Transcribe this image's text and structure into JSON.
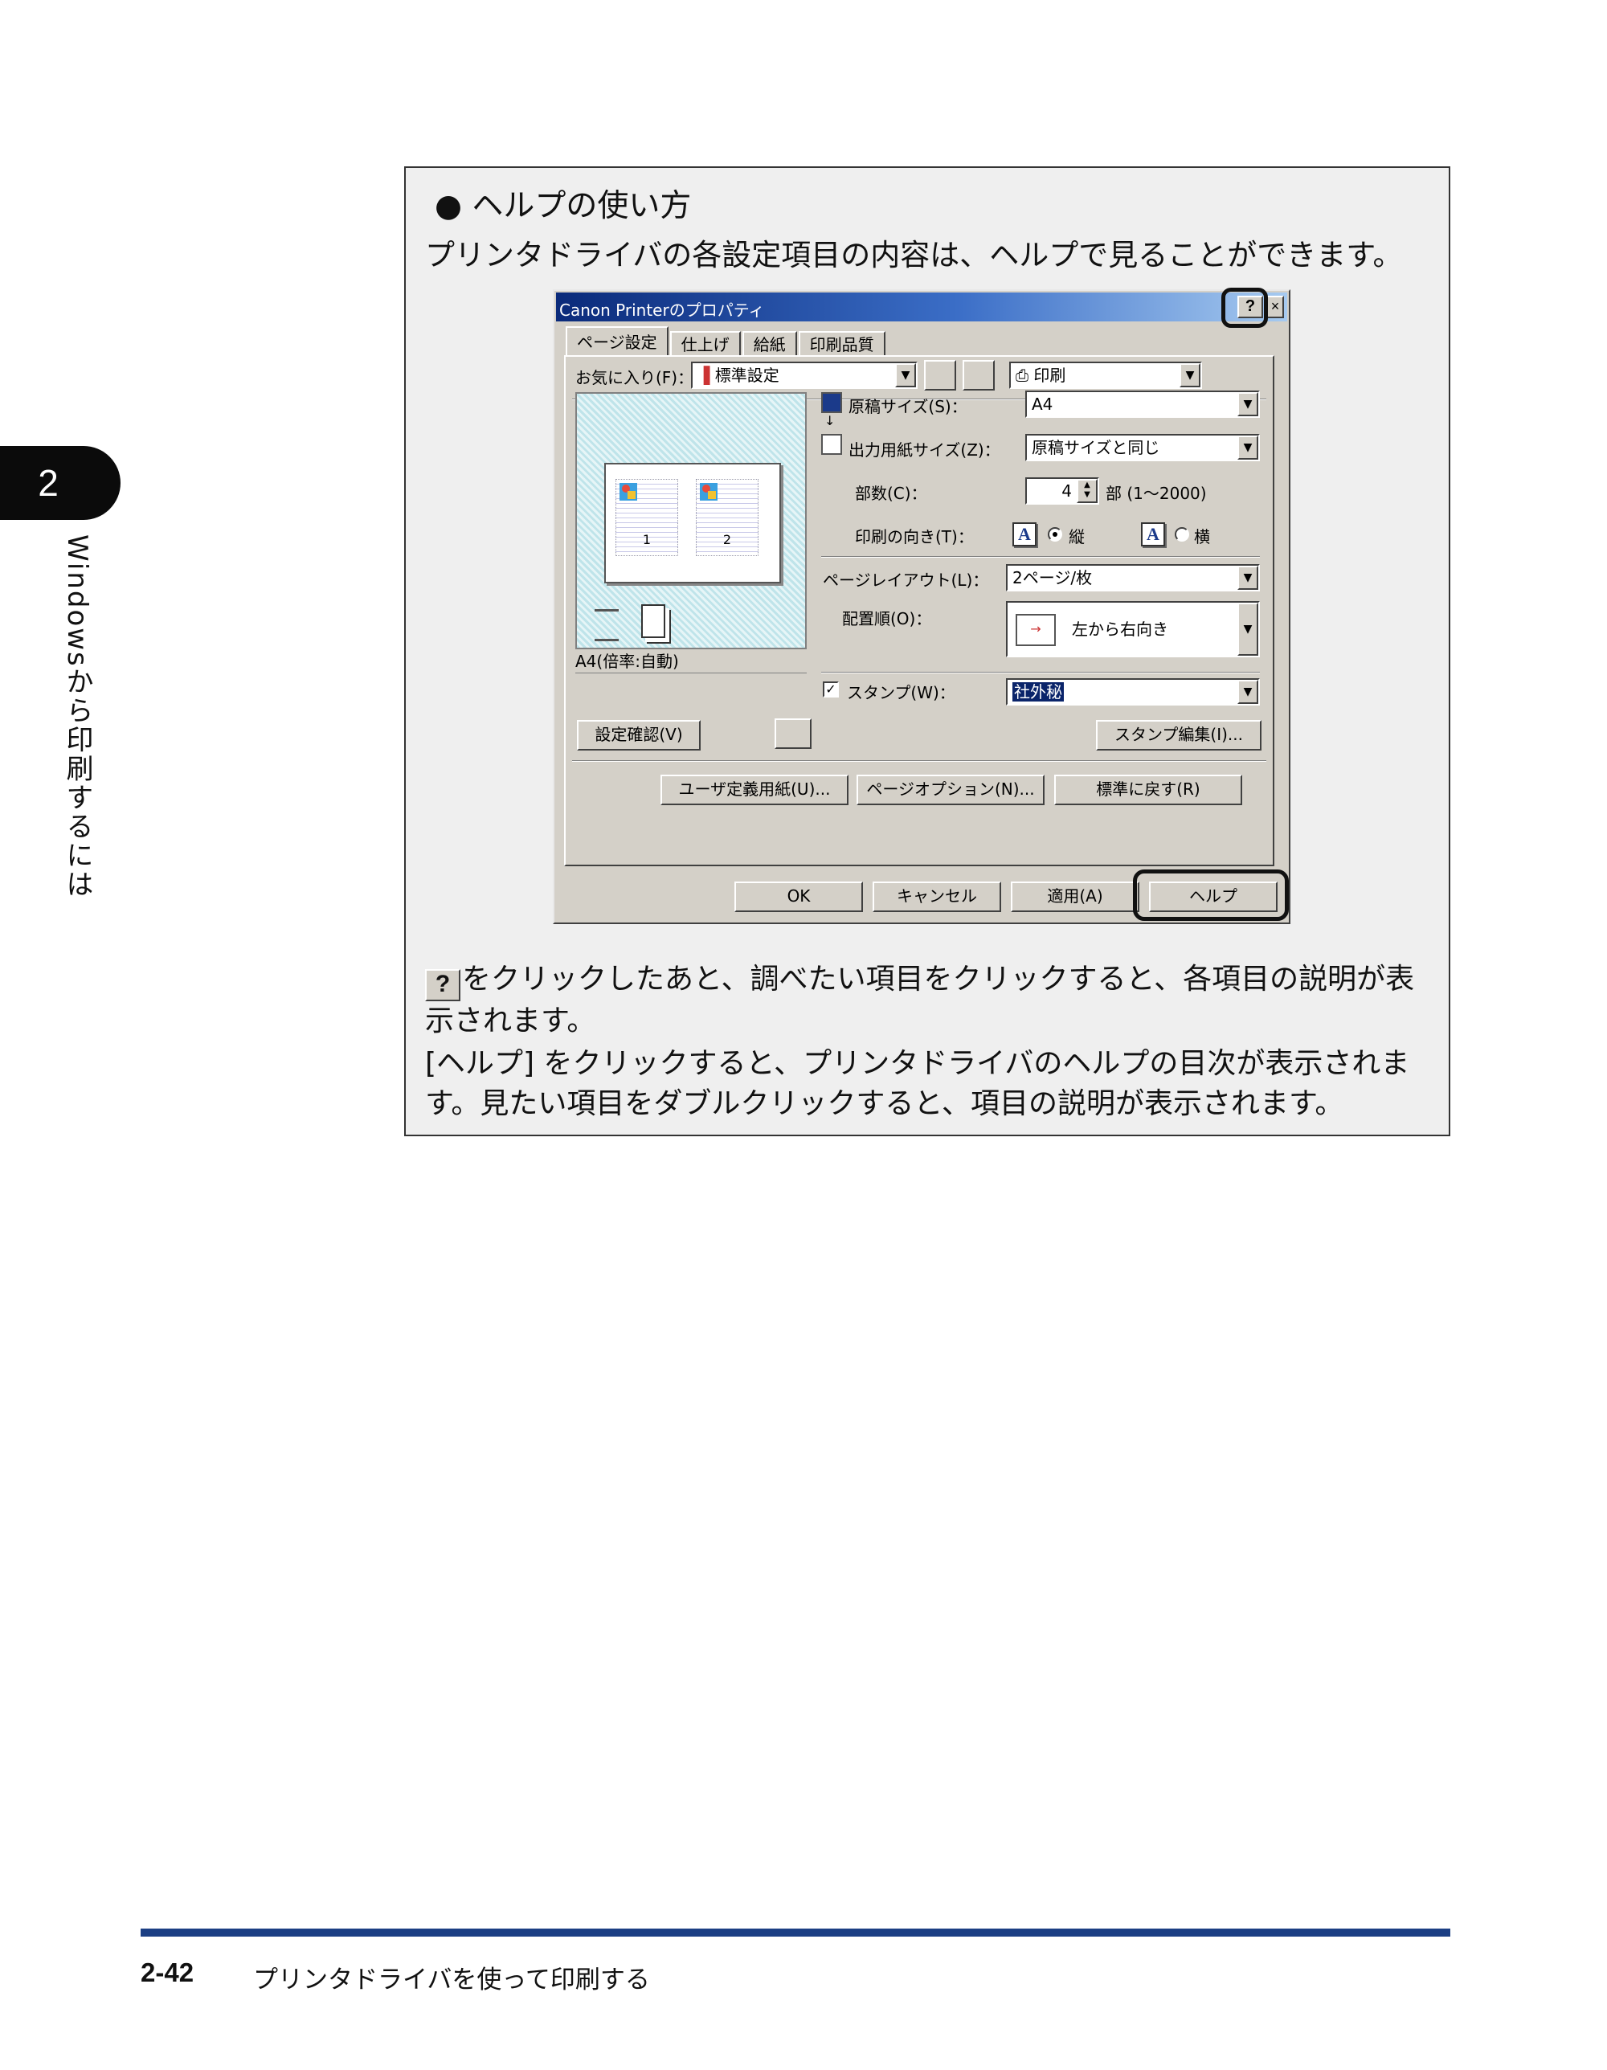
{
  "chapter": {
    "number": "2",
    "side_title": "Windowsから印刷するには"
  },
  "note": {
    "title": "● ヘルプの使い方",
    "lead": "プリンタドライバの各設定項目の内容は、ヘルプで見ることができます。",
    "help_badge": "?",
    "p1": "をクリックしたあと、調べたい項目をクリックすると、各項目の説明が表示されます。",
    "p2": "[ヘルプ] をクリックすると、プリンタドライバのヘルプの目次が表示されます。見たい項目をダブルクリックすると、項目の説明が表示されます。"
  },
  "dialog": {
    "title": "Canon Printerのプロパティ",
    "help_btn": "?",
    "close_btn": "×",
    "tabs": [
      "ページ設定",
      "仕上げ",
      "給紙",
      "印刷品質"
    ],
    "favorites_label": "お気に入り(F)：",
    "favorites_value": "標準設定",
    "output_value": "印刷",
    "original_size_label": "原稿サイズ(S)：",
    "original_size_value": "A4",
    "output_size_label": "出力用紙サイズ(Z)：",
    "output_size_value": "原稿サイズと同じ",
    "copies_label": "部数(C)：",
    "copies_value": "4",
    "copies_unit": "部 (1～2000)",
    "orientation_label": "印刷の向き(T)：",
    "orientation_portrait": "縦",
    "orientation_landscape": "横",
    "orientation_glyph": "A",
    "layout_label": "ページレイアウト(L)：",
    "layout_value": "2ページ/枚",
    "order_label": "配置順(O)：",
    "order_value": "左から右向き",
    "stamp_label": "スタンプ(W)：",
    "stamp_value": "社外秘",
    "stamp_edit_btn": "スタンプ編集(I)...",
    "preview_page1": "1",
    "preview_page2": "2",
    "preview_status": "A4(倍率:自動)",
    "confirm_btn": "設定確認(V)",
    "custom_paper_btn": "ユーザ定義用紙(U)...",
    "page_option_btn": "ページオプション(N)...",
    "restore_btn": "標準に戻す(R)",
    "ok_btn": "OK",
    "cancel_btn": "キャンセル",
    "apply_btn": "適用(A)",
    "help_bottom_btn": "ヘルプ"
  },
  "footer": {
    "page": "2-42",
    "title": "プリンタドライバを使って印刷する"
  },
  "colors": {
    "footer_rule": "#1c3f84",
    "dialog_face": "#d4d0c8",
    "note_bg": "#efefef"
  }
}
